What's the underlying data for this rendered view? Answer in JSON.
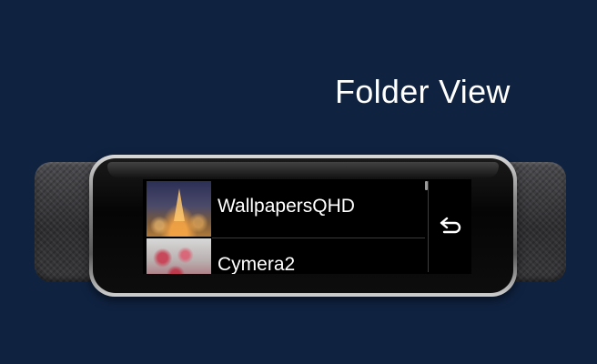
{
  "heading": "Folder View",
  "folders": [
    {
      "label": "WallpapersQHD"
    },
    {
      "label": "Cymera2"
    }
  ],
  "icons": {
    "back": "back-arrow-icon"
  }
}
